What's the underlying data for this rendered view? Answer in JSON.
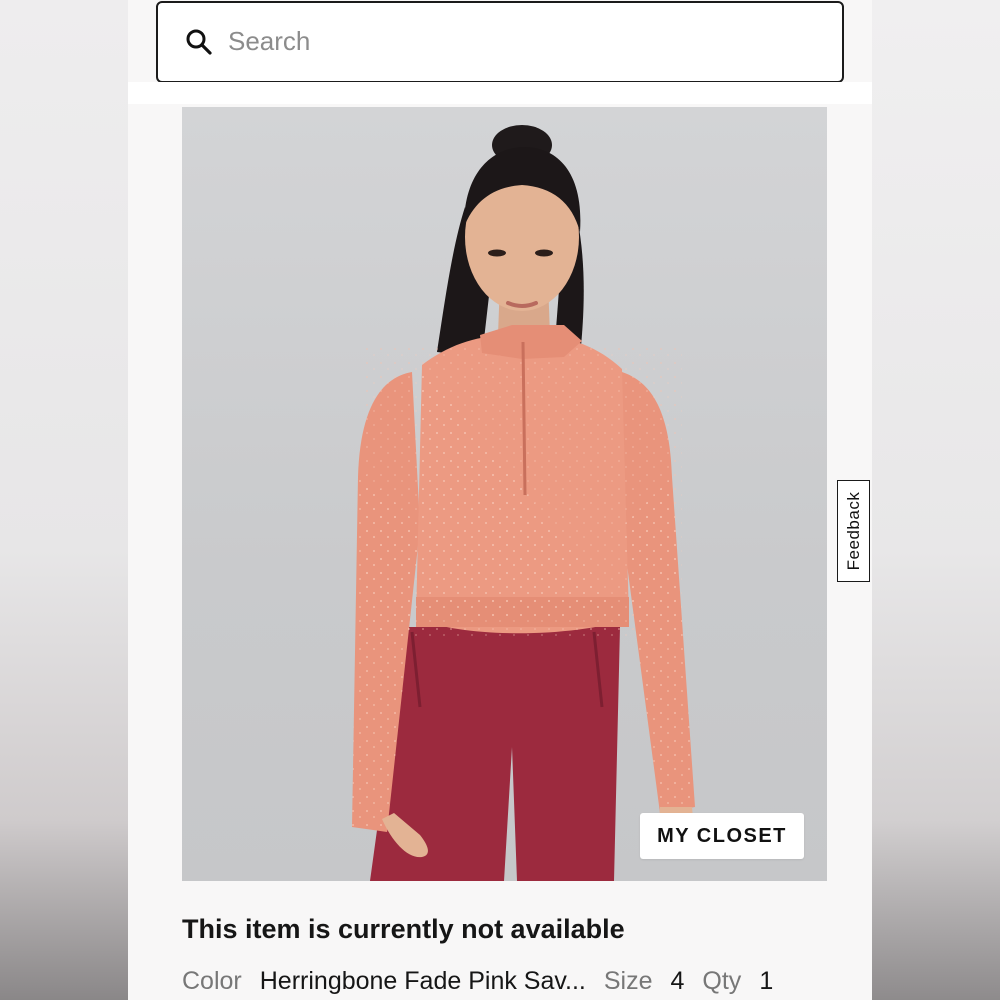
{
  "search": {
    "placeholder": "Search"
  },
  "product": {
    "closet_button": "MY CLOSET",
    "availability": "This item is currently not available",
    "color_label": "Color",
    "color_value": "Herringbone Fade Pink Sav...",
    "size_label": "Size",
    "size_value": "4",
    "qty_label": "Qty",
    "qty_value": "1"
  },
  "feedback": {
    "label": "Feedback"
  },
  "icons": {
    "search": "search-icon"
  },
  "colors": {
    "border": "#1b1b1b",
    "top_color": "#e9947c",
    "leggings_color": "#9c2a3e",
    "image_background": "#c9cacc"
  }
}
